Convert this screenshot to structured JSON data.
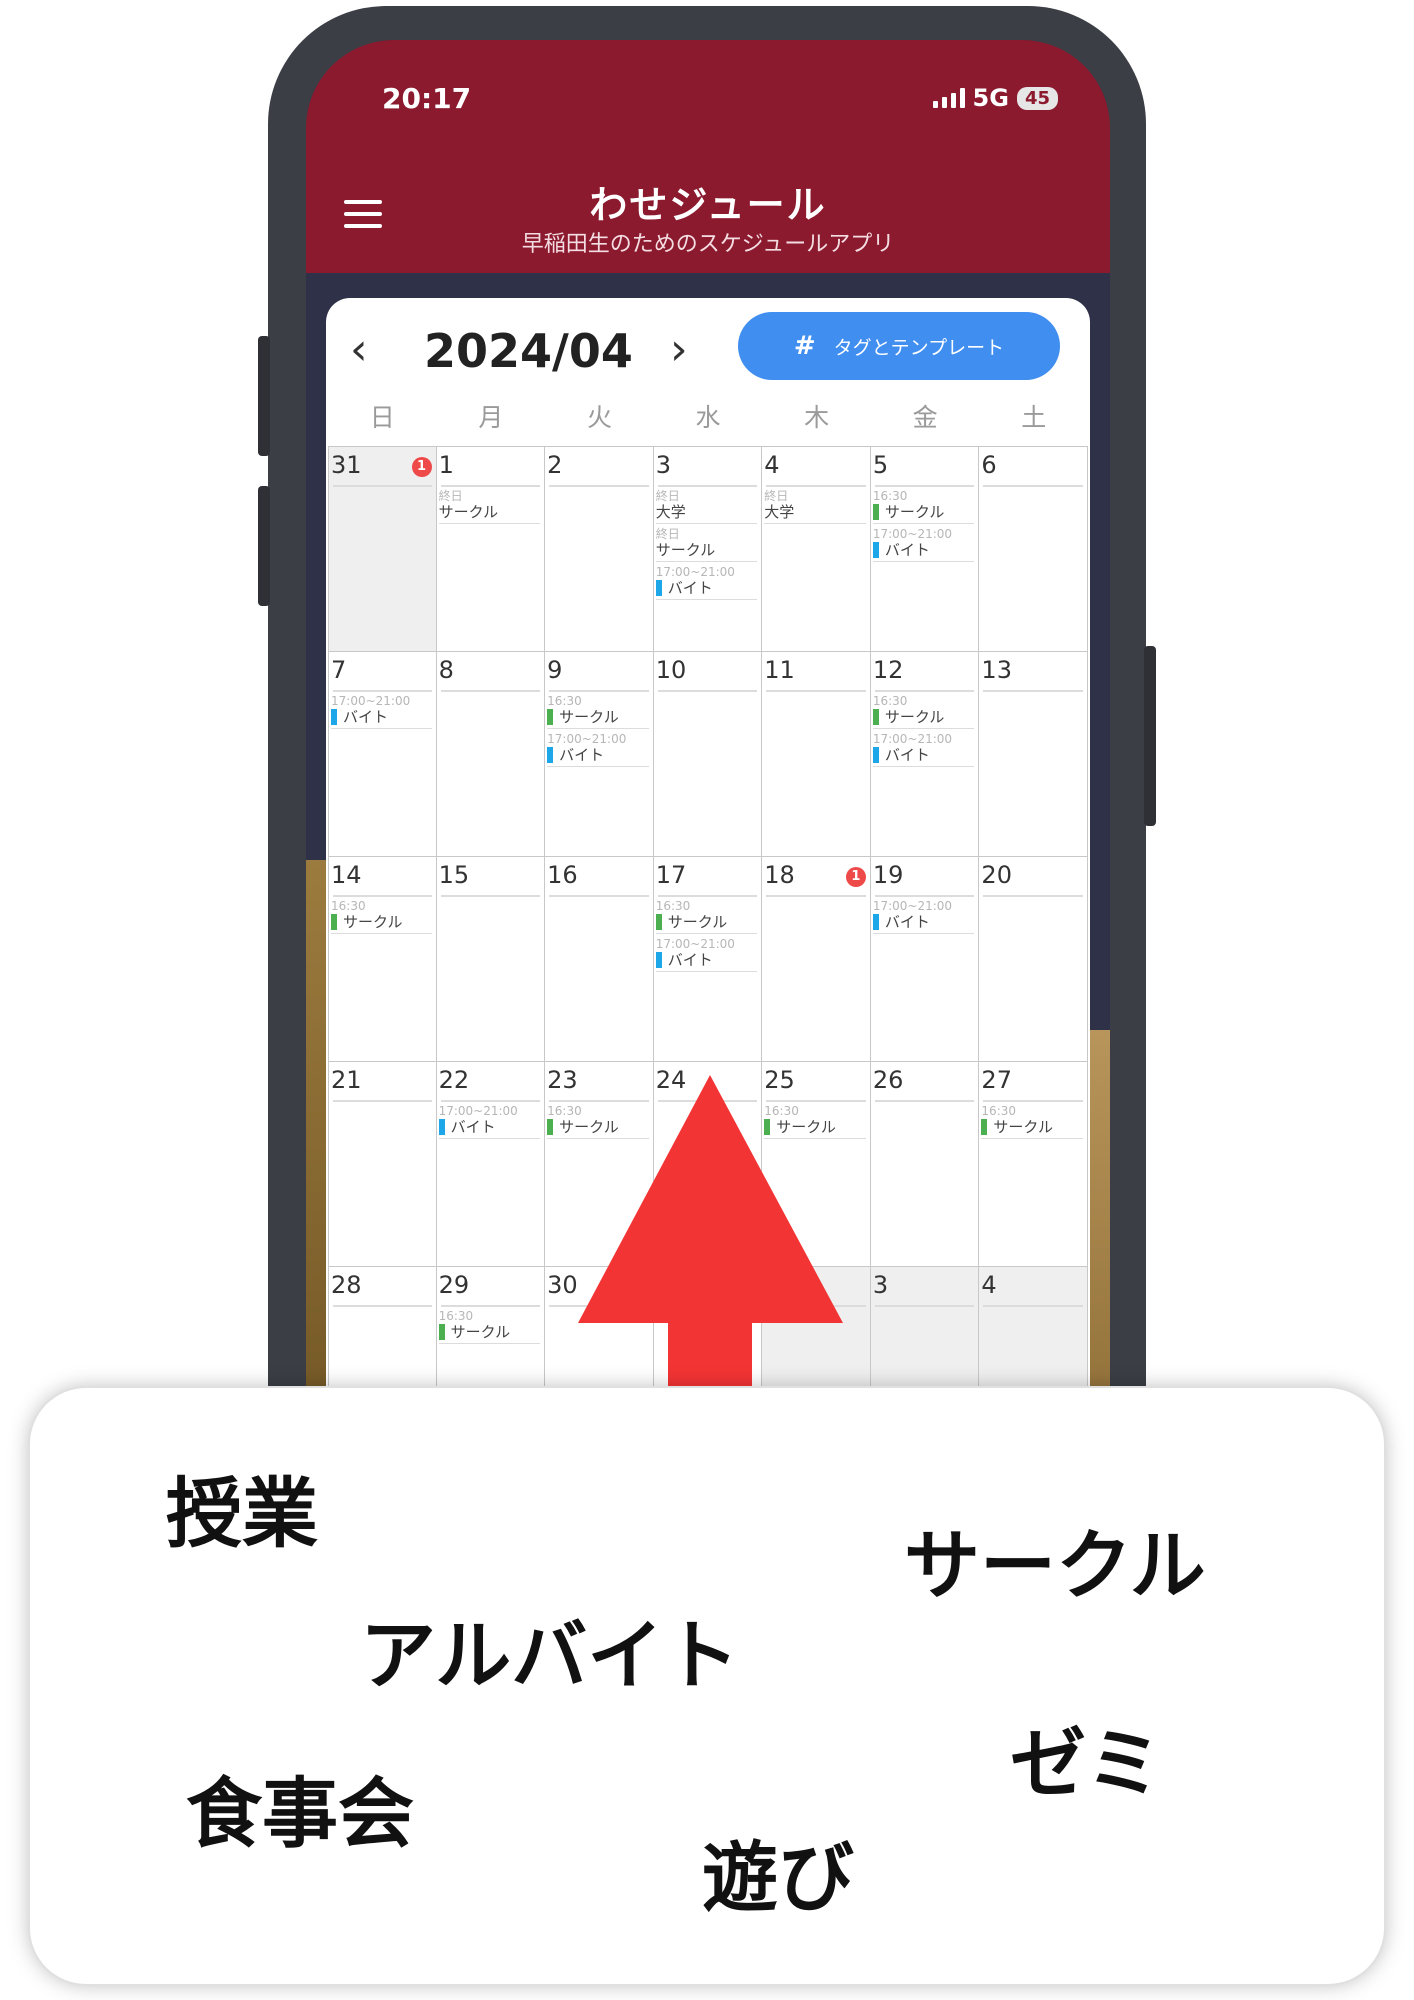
{
  "status_bar": {
    "time": "20:17",
    "network": "5G",
    "battery": "45"
  },
  "app": {
    "title": "わせジュール",
    "subtitle": "早稲田生のためのスケジュールアプリ"
  },
  "calendar": {
    "month_label": "2024/04",
    "prev_label": "‹",
    "next_label": "›",
    "tag_button_label": "タグとテンプレート",
    "weekdays": [
      "日",
      "月",
      "火",
      "水",
      "木",
      "金",
      "土"
    ],
    "colors": {
      "circle": "#4caf50",
      "part_time": "#1ea7e8",
      "header": "#8b1a2e",
      "button": "#3f8ef0",
      "badge": "#ef4a4a",
      "arrow": "#f33434"
    },
    "weeks": [
      [
        {
          "day": "31",
          "muted": true,
          "badge": "1",
          "events": []
        },
        {
          "day": "1",
          "events": [
            {
              "time": "終日",
              "title": "サークル"
            }
          ]
        },
        {
          "day": "2",
          "events": []
        },
        {
          "day": "3",
          "events": [
            {
              "time": "終日",
              "title": "大学"
            },
            {
              "time": "終日",
              "title": "サークル"
            },
            {
              "time": "17:00~21:00",
              "title": "バイト",
              "color": "part_time"
            }
          ]
        },
        {
          "day": "4",
          "events": [
            {
              "time": "終日",
              "title": "大学"
            }
          ]
        },
        {
          "day": "5",
          "events": [
            {
              "time": "16:30",
              "title": "サークル",
              "color": "circle"
            },
            {
              "time": "17:00~21:00",
              "title": "バイト",
              "color": "part_time"
            }
          ]
        },
        {
          "day": "6",
          "events": []
        }
      ],
      [
        {
          "day": "7",
          "events": [
            {
              "time": "17:00~21:00",
              "title": "バイト",
              "color": "part_time"
            }
          ]
        },
        {
          "day": "8",
          "events": []
        },
        {
          "day": "9",
          "events": [
            {
              "time": "16:30",
              "title": "サークル",
              "color": "circle"
            },
            {
              "time": "17:00~21:00",
              "title": "バイト",
              "color": "part_time"
            }
          ]
        },
        {
          "day": "10",
          "events": []
        },
        {
          "day": "11",
          "events": []
        },
        {
          "day": "12",
          "events": [
            {
              "time": "16:30",
              "title": "サークル",
              "color": "circle"
            },
            {
              "time": "17:00~21:00",
              "title": "バイト",
              "color": "part_time"
            }
          ]
        },
        {
          "day": "13",
          "events": []
        }
      ],
      [
        {
          "day": "14",
          "events": [
            {
              "time": "16:30",
              "title": "サークル",
              "color": "circle"
            }
          ]
        },
        {
          "day": "15",
          "events": []
        },
        {
          "day": "16",
          "events": []
        },
        {
          "day": "17",
          "events": [
            {
              "time": "16:30",
              "title": "サークル",
              "color": "circle"
            },
            {
              "time": "17:00~21:00",
              "title": "バイト",
              "color": "part_time"
            }
          ]
        },
        {
          "day": "18",
          "badge": "1",
          "events": []
        },
        {
          "day": "19",
          "events": [
            {
              "time": "17:00~21:00",
              "title": "バイト",
              "color": "part_time"
            }
          ]
        },
        {
          "day": "20",
          "events": []
        }
      ],
      [
        {
          "day": "21",
          "events": []
        },
        {
          "day": "22",
          "events": [
            {
              "time": "17:00~21:00",
              "title": "バイト",
              "color": "part_time"
            }
          ]
        },
        {
          "day": "23",
          "events": [
            {
              "time": "16:30",
              "title": "サークル",
              "color": "circle"
            }
          ]
        },
        {
          "day": "24",
          "events": []
        },
        {
          "day": "25",
          "events": [
            {
              "time": "16:30",
              "title": "サークル",
              "color": "circle"
            }
          ]
        },
        {
          "day": "26",
          "events": []
        },
        {
          "day": "27",
          "events": [
            {
              "time": "16:30",
              "title": "サークル",
              "color": "circle"
            }
          ]
        }
      ],
      [
        {
          "day": "28",
          "events": []
        },
        {
          "day": "29",
          "events": [
            {
              "time": "16:30",
              "title": "サークル",
              "color": "circle"
            }
          ]
        },
        {
          "day": "30",
          "events": []
        },
        {
          "day": "",
          "events": []
        },
        {
          "day": "2",
          "muted": true,
          "events": []
        },
        {
          "day": "3",
          "muted": true,
          "events": []
        },
        {
          "day": "4",
          "muted": true,
          "events": []
        }
      ]
    ]
  },
  "tags": {
    "class": "授業",
    "circle": "サークル",
    "part_time": "アルバイト",
    "seminar": "ゼミ",
    "dinner": "食事会",
    "play": "遊び"
  }
}
